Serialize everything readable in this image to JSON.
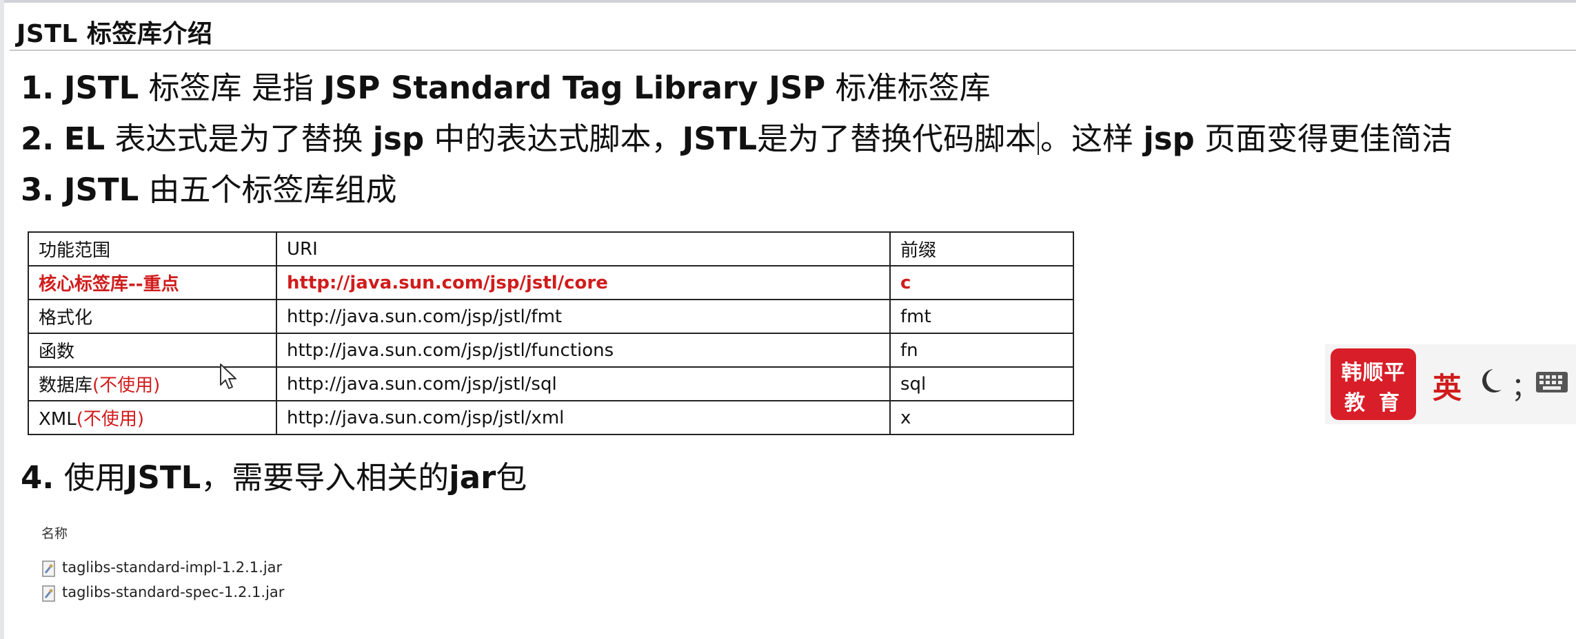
{
  "slide_title": "JSTL 标签库介绍",
  "points": {
    "p1": {
      "num": "1.",
      "a": "JSTL",
      "b": " 标签库 是指 ",
      "c": "JSP Standard Tag Library JSP",
      "d": " 标准标签库"
    },
    "p2": {
      "num": "2.",
      "a": "EL",
      "b": " 表达式是为了替换 ",
      "c": "jsp",
      "d": " 中的表达式脚本，",
      "e": "JSTL",
      "f": "是为了替换代码脚本",
      "g": "。这样 ",
      "h": "jsp",
      "i": " 页面变得更佳简洁"
    },
    "p3": {
      "num": "3.",
      "a": "JSTL",
      "b": " 由五个标签库组成"
    },
    "p4": {
      "num": "4.",
      "a": "使用",
      "b": "JSTL",
      "c": "，需要导入相关的",
      "d": "jar",
      "e": "包"
    }
  },
  "table": {
    "headers": [
      "功能范围",
      "URI",
      "前缀"
    ],
    "rows": [
      {
        "name": "核心标签库--重点",
        "note": "",
        "uri": "http://java.sun.com/jsp/jstl/core",
        "prefix": "c"
      },
      {
        "name": "格式化",
        "note": "",
        "uri": "http://java.sun.com/jsp/jstl/fmt",
        "prefix": "fmt"
      },
      {
        "name": "函数",
        "note": "",
        "uri": "http://java.sun.com/jsp/jstl/functions",
        "prefix": "fn"
      },
      {
        "name": "数据库",
        "note": "(不使用)",
        "uri": "http://java.sun.com/jsp/jstl/sql",
        "prefix": "sql"
      },
      {
        "name": "XML",
        "note": "(不使用)",
        "uri": "http://java.sun.com/jsp/jstl/xml",
        "prefix": "x"
      }
    ]
  },
  "file_list": {
    "header": "名称",
    "files": [
      "taglibs-standard-impl-1.2.1.jar",
      "taglibs-standard-spec-1.2.1.jar"
    ]
  },
  "badge": {
    "logo_line1": "韩顺平",
    "logo_line2": "教育",
    "ime_lang": "英",
    "ime_punct": "；"
  },
  "colors": {
    "highlight_red": "#d01c1c",
    "logo_red": "#d81e28"
  }
}
